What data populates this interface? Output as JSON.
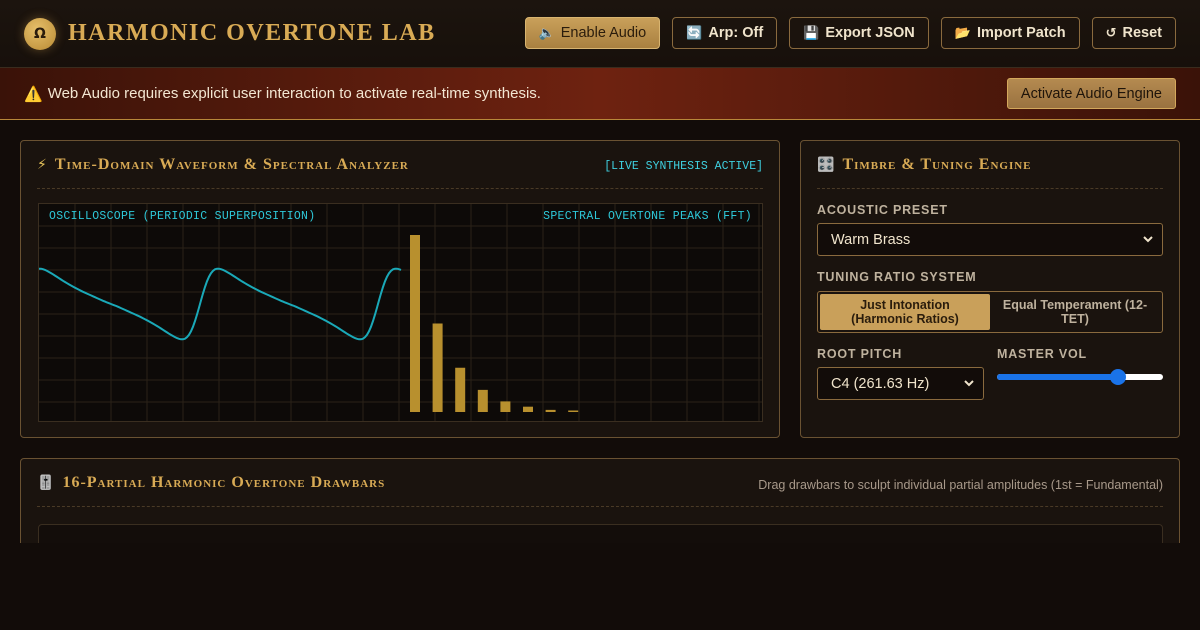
{
  "header": {
    "logo_glyph": "Ω",
    "title": "HARMONIC OVERTONE LAB",
    "buttons": [
      {
        "icon": "🔈",
        "icon_name": "speaker-icon",
        "label": "Enable Audio",
        "primary": true
      },
      {
        "icon": "🔄",
        "icon_name": "refresh-icon",
        "label": "Arp: Off"
      },
      {
        "icon": "💾",
        "icon_name": "floppy-disk-icon",
        "label": "Export JSON"
      },
      {
        "icon": "📂",
        "icon_name": "folder-icon",
        "label": "Import Patch"
      },
      {
        "icon": "↺",
        "icon_name": "reset-icon",
        "label": "Reset"
      }
    ]
  },
  "banner": {
    "icon": "⚠️",
    "text": "Web Audio requires explicit user interaction to activate real-time synthesis.",
    "button": "Activate Audio Engine"
  },
  "analyzer": {
    "icon": "⚡",
    "title": "Time-Domain Waveform & Spectral Analyzer",
    "badge": "[LIVE SYNTHESIS ACTIVE]",
    "left_label": "OSCILLOSCOPE (PERIODIC SUPERPOSITION)",
    "right_label": "SPECTRAL OVERTONE PEAKS (FFT)",
    "spectrum": [
      1.0,
      0.5,
      0.25,
      0.125,
      0.06,
      0.03,
      0.012,
      0.006
    ],
    "colors": {
      "wave": "#1aa9b8",
      "bars": "#b8902e",
      "grid": "#2a2218"
    }
  },
  "timbre": {
    "icon": "🎛️",
    "title": "Timbre & Tuning Engine",
    "preset_label": "ACOUSTIC PRESET",
    "preset_value": "Warm Brass",
    "tuning_label": "TUNING RATIO SYSTEM",
    "tuning_options": [
      "Just Intonation (Harmonic Ratios)",
      "Equal Temperament (12-TET)"
    ],
    "tuning_selected": 0,
    "root_label": "ROOT PITCH",
    "root_value": "C4 (261.63 Hz)",
    "volume_label": "MASTER VOL",
    "volume": 0.75
  },
  "drawbars": {
    "icon": "🎚️",
    "title": "16-Partial Harmonic Overtone Drawbars",
    "hint": "Drag drawbars to sculpt individual partial amplitudes (1st = Fundamental)"
  }
}
